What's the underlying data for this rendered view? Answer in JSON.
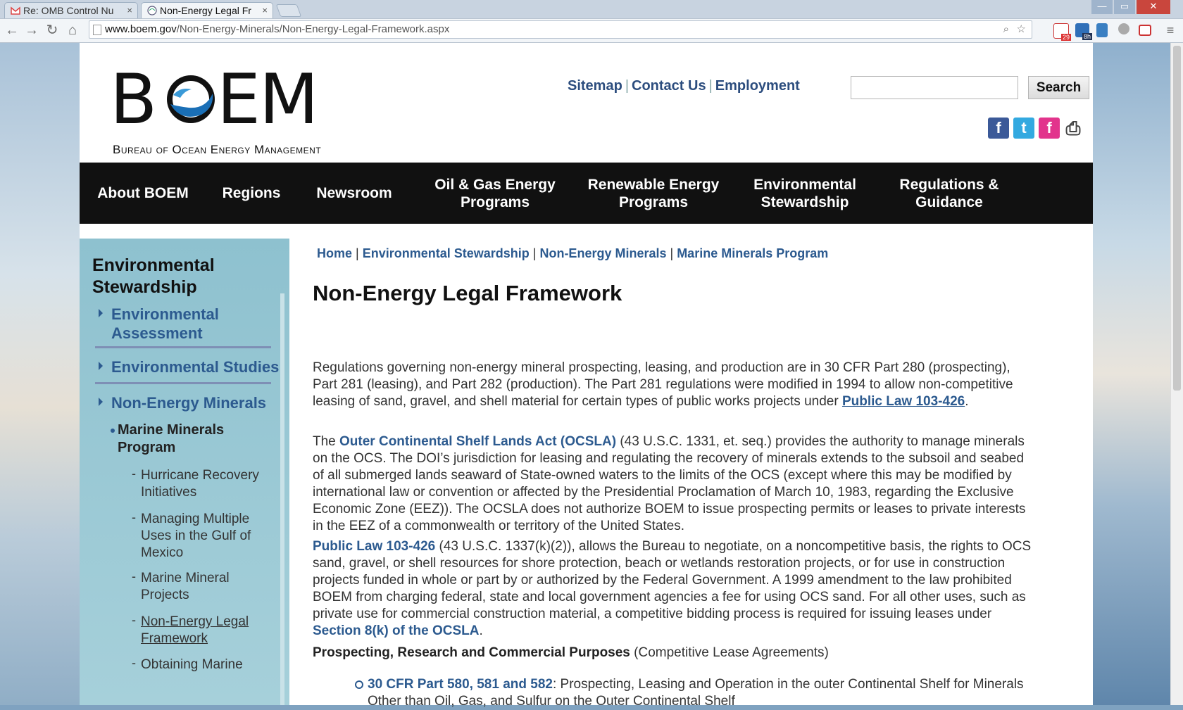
{
  "browser": {
    "tabs": [
      {
        "label": "Re: OMB Control Nu",
        "close": "×"
      },
      {
        "label": "Non-Energy Legal Fr",
        "close": "×"
      }
    ],
    "url_host": "www.boem.gov",
    "url_path": "/Non-Energy-Minerals/Non-Energy-Legal-Framework.aspx",
    "window_controls": {
      "min": "—",
      "max": "▭",
      "close": "✕"
    },
    "extension_badges": {
      "gmail_count": "29",
      "calendar_count": "8h"
    }
  },
  "header": {
    "logo_main": "BOEM",
    "logo_sub": "Bureau of Ocean Energy Management",
    "links": [
      "Sitemap",
      "Contact Us",
      "Employment"
    ],
    "search_placeholder": "",
    "search_button": "Search",
    "separator": "|",
    "social": {
      "facebook": "f",
      "twitter": "t",
      "flickr": "f",
      "print": "⎙"
    }
  },
  "nav": {
    "items": [
      "About BOEM",
      "Regions",
      "Newsroom",
      "Oil & Gas Energy Programs",
      "Renewable Energy Programs",
      "Environmental Stewardship",
      "Regulations & Guidance"
    ]
  },
  "sidebar": {
    "title": "Environmental Stewardship",
    "sections": [
      "Environmental Assessment",
      "Environmental Studies",
      "Non-Energy Minerals"
    ],
    "current": "Marine Minerals Program",
    "subitems": [
      "Hurricane Recovery Initiatives",
      "Managing Multiple Uses in the Gulf of Mexico",
      "Marine Mineral Projects",
      "Non-Energy Legal Framework",
      "Obtaining Marine"
    ],
    "dash": "-"
  },
  "content": {
    "breadcrumb": [
      "Home",
      "Environmental Stewardship",
      "Non-Energy Minerals",
      "Marine Minerals Program"
    ],
    "breadcrumb_sep": "|",
    "title": "Non-Energy Legal Framework",
    "p1_text": "Regulations governing non-energy mineral prospecting, leasing, and production are in 30 CFR Part 280 (prospecting), Part 281 (leasing), and Part 282 (production). The Part 281 regulations were modified in 1994 to allow non-competitive leasing of sand, gravel, and shell material for certain types of public works projects under ",
    "p1_link": "Public Law 103-426",
    "p1_end": ".",
    "p2_start": "The ",
    "p2_link": "Outer Continental Shelf Lands Act (OCSLA)",
    "p2_text": " (43 U.S.C. 1331, et. seq.) provides the authority to manage minerals on the OCS. The DOI’s jurisdiction for leasing and regulating the recovery of minerals extends to the subsoil and seabed of all submerged lands seaward of State-owned waters to the limits of the OCS (except where this may be modified by international law or convention or affected by the Presidential Proclamation of March 10, 1983, regarding the Exclusive Economic Zone (EEZ)). The OCSLA does not authorize BOEM to issue prospecting permits or leases to private interests in the EEZ of a commonwealth or territory of the United States.",
    "p3_link": "Public Law 103-426",
    "p3_text": " (43 U.S.C. 1337(k)(2)), allows the Bureau to negotiate, on a noncompetitive basis, the rights to OCS sand, gravel, or shell resources for shore protection, beach or wetlands restoration projects, or for use in construction projects funded in whole or part by or authorized by the Federal Government. A 1999 amendment to the law prohibited BOEM from charging federal, state and local government agencies a fee for using OCS sand. For all other uses, such as private use for commercial construction material, a competitive bidding process is required for issuing leases under ",
    "p3_link2": "Section 8(k) of the OCSLA",
    "p3_end": ".",
    "h2_bold": "Prospecting, Research and Commercial Purposes",
    "h2_rest": " (Competitive Lease Agreements)",
    "li1_link": "30 CFR Part 580, 581 and 582",
    "li1_text": ": Prospecting, Leasing and Operation in the outer Continental Shelf for Minerals Other than Oil, Gas, and Sulfur on the Outer Continental Shelf"
  }
}
